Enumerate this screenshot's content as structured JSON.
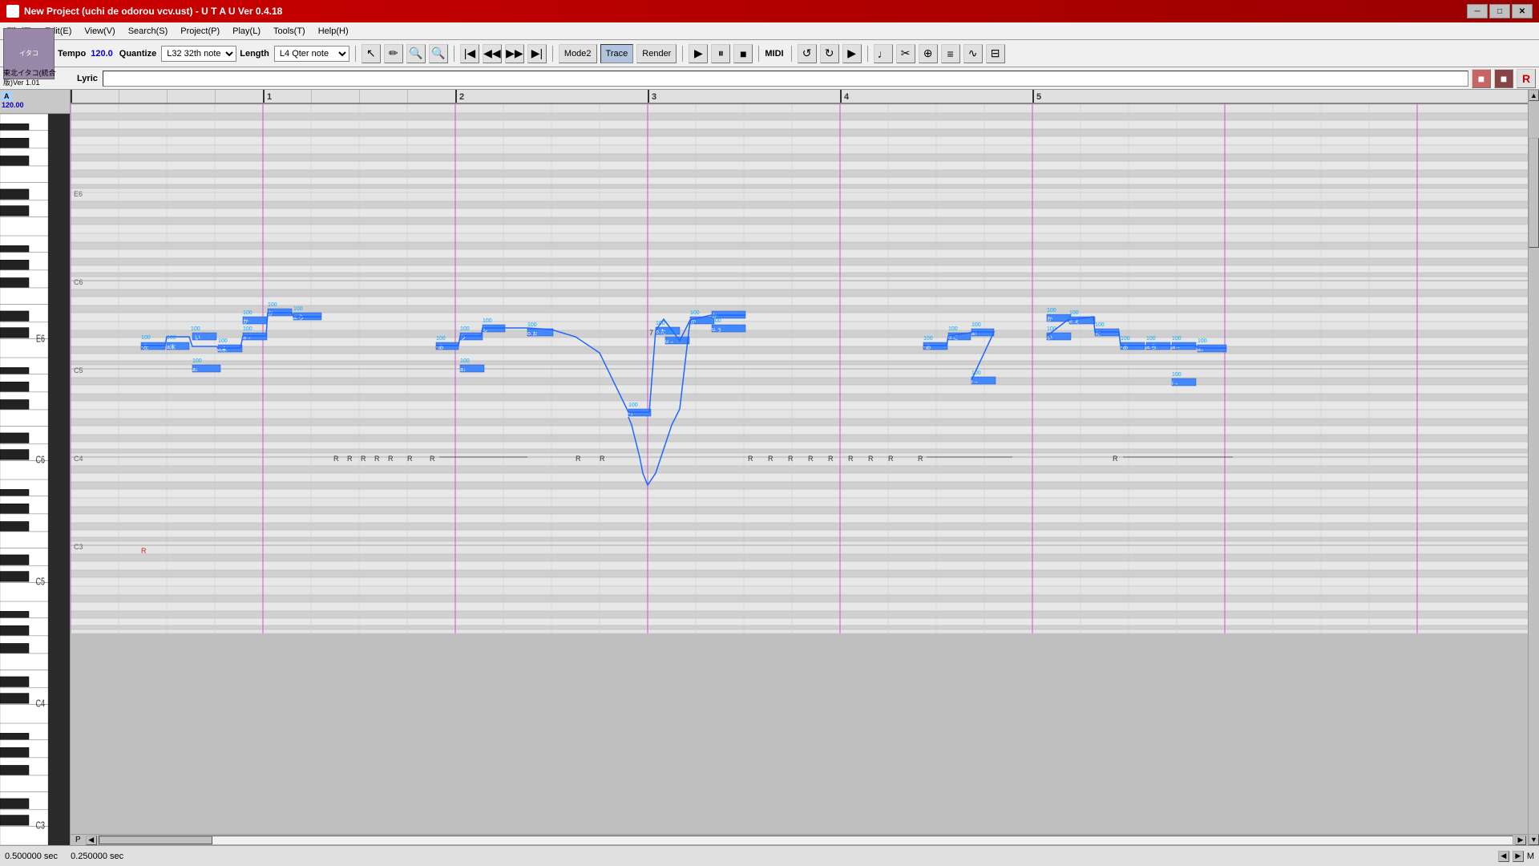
{
  "window": {
    "title": "New Project (uchi de odorou vcv.ust) - U T A U Ver 0.4.18",
    "icon": "♪"
  },
  "titlebar": {
    "minimize": "─",
    "restore": "□",
    "close": "✕"
  },
  "menu": {
    "items": [
      "File(F)",
      "Edit(E)",
      "View(V)",
      "Search(S)",
      "Project(P)",
      "Play(L)",
      "Tools(T)",
      "Help(H)"
    ]
  },
  "toolbar": {
    "tempo_label": "Tempo",
    "tempo_value": "120.0",
    "quantize_label": "Quantize",
    "quantize_value": "L32 32th note",
    "length_label": "Length",
    "length_value": "L4 Qter note",
    "mode2_label": "Mode2",
    "trace_label": "Trace",
    "render_label": "Render",
    "lyric_label": "Lyric",
    "midi_label": "MIDI"
  },
  "track": {
    "name": "東北イタコ(統合",
    "version": "版)Ver 1.01",
    "tempo_display": "120.00",
    "prefix": "A"
  },
  "ruler": {
    "marks": [
      "1",
      "2",
      "3",
      "4",
      "5"
    ]
  },
  "piano": {
    "labels": [
      "E6",
      "C6",
      "C5",
      "C4",
      "C3"
    ]
  },
  "status": {
    "time1": "0.500000 sec",
    "time2": "0.250000 sec",
    "scroll_label": "P"
  },
  "grid": {
    "note_color": "#4488ff",
    "bar_line_color": "#cc55cc",
    "beat_line_color": "#c8c8c8"
  }
}
